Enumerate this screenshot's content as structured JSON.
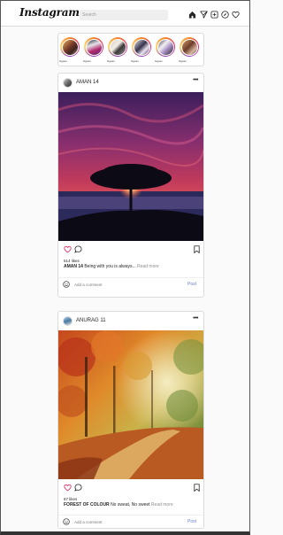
{
  "navbar": {
    "logo": "Instagram",
    "search_placeholder": "Search",
    "icons": [
      "home-icon",
      "send-icon",
      "add-icon",
      "explore-icon",
      "heart-icon"
    ]
  },
  "stories": [
    {
      "username": "bigsan"
    },
    {
      "username": "bigsan"
    },
    {
      "username": "bigsan"
    },
    {
      "username": "bigsan"
    },
    {
      "username": "bigsan"
    },
    {
      "username": "bigsan"
    }
  ],
  "posts": [
    {
      "username": "AMAN 14",
      "likes": "514 likes",
      "caption_user": "AMAN 14",
      "caption_text": "Being with you is always...",
      "read_more": "Read more",
      "comment_placeholder": "Add a comment",
      "post_label": "Post"
    },
    {
      "username": "ANURAG 11",
      "likes": "67 likes",
      "caption_user": "FOREST OF COLOUR",
      "caption_text": "No sweat, No sweet",
      "read_more": "Read more",
      "comment_placeholder": "Add a comment",
      "post_label": "Post"
    }
  ],
  "colors": {
    "accent": "#6a7bd0",
    "border": "#dbdbdb",
    "background": "#fafafa"
  }
}
